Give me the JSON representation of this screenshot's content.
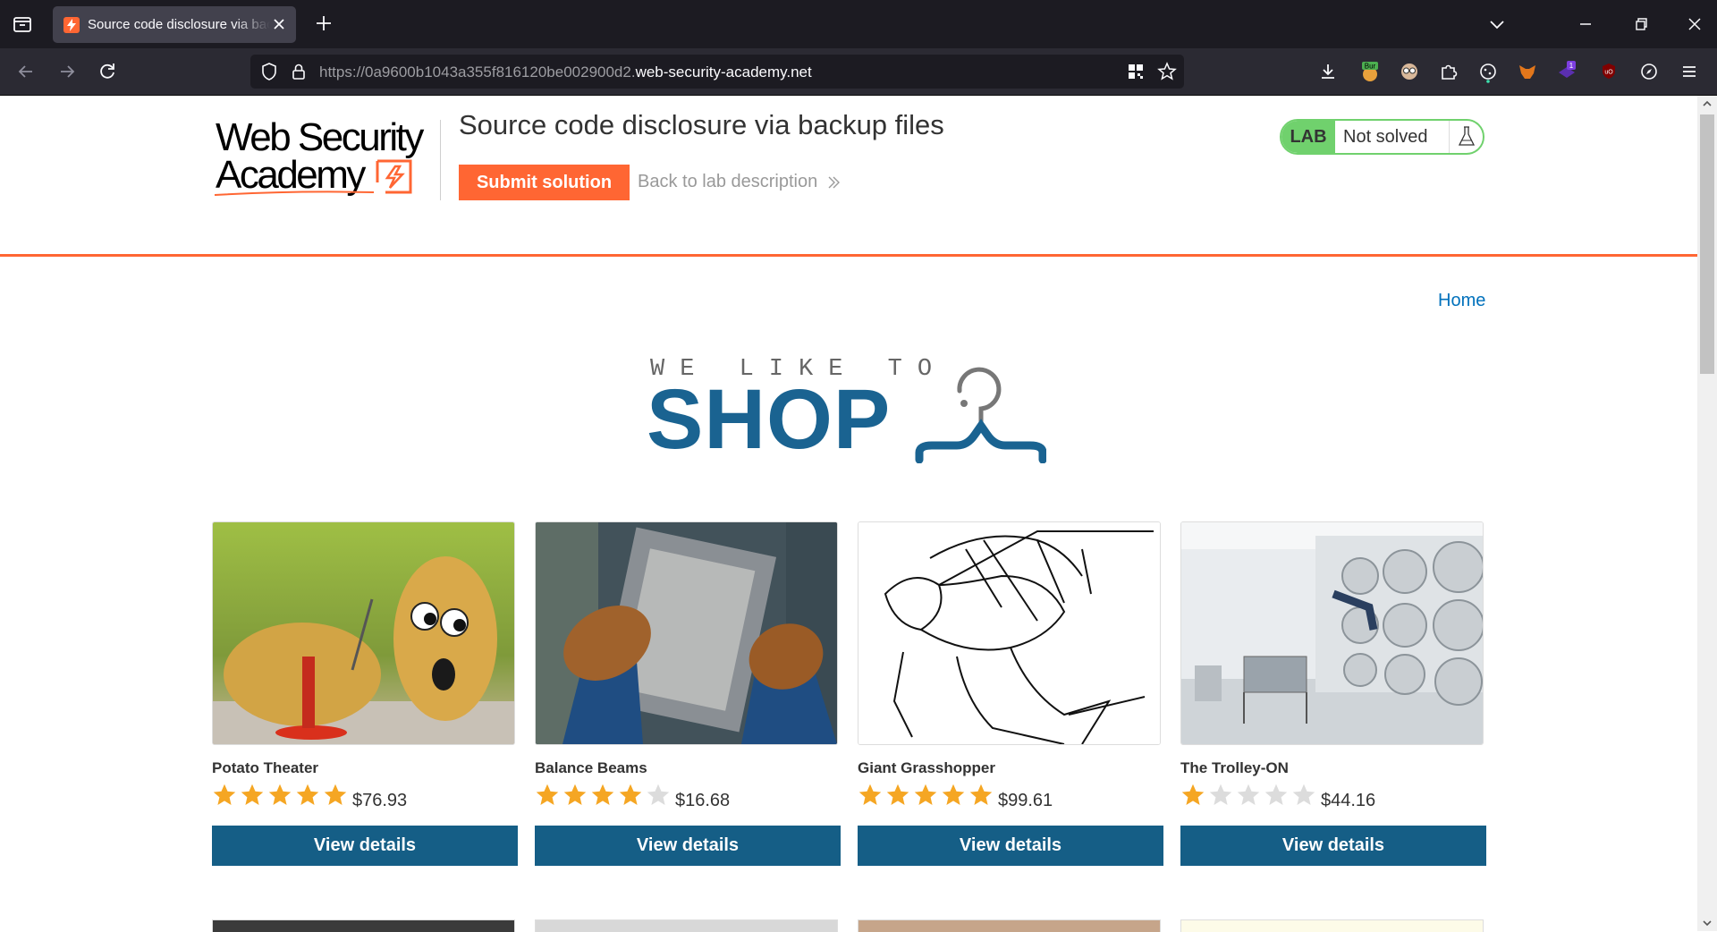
{
  "browser": {
    "tab_title": "Source code disclosure via backup files",
    "url_prefix": "https://0a9600b1043a355f816120be002900d2.",
    "url_domain": "web-security-academy.net"
  },
  "header": {
    "logo_line1": "Web Security",
    "logo_line2": "Academy",
    "lab_title": "Source code disclosure via backup files",
    "submit_label": "Submit solution",
    "back_label": "Back to lab description",
    "lab_badge_label": "LAB",
    "lab_status": "Not solved"
  },
  "nav": {
    "home_label": "Home"
  },
  "banner": {
    "tagline": "WE LIKE TO",
    "title": "SHOP"
  },
  "products": [
    {
      "name": "Potato Theater",
      "price": "$76.93",
      "rating": 5,
      "button": "View details"
    },
    {
      "name": "Balance Beams",
      "price": "$16.68",
      "rating": 4,
      "button": "View details"
    },
    {
      "name": "Giant Grasshopper",
      "price": "$99.61",
      "rating": 5,
      "button": "View details"
    },
    {
      "name": "The Trolley-ON",
      "price": "$44.16",
      "rating": 1,
      "button": "View details"
    }
  ],
  "colors": {
    "accent": "#ff6633",
    "button": "#155e86",
    "lab_green": "#70d16d",
    "star_on": "#f5a623",
    "star_off": "#dcdcdc"
  }
}
